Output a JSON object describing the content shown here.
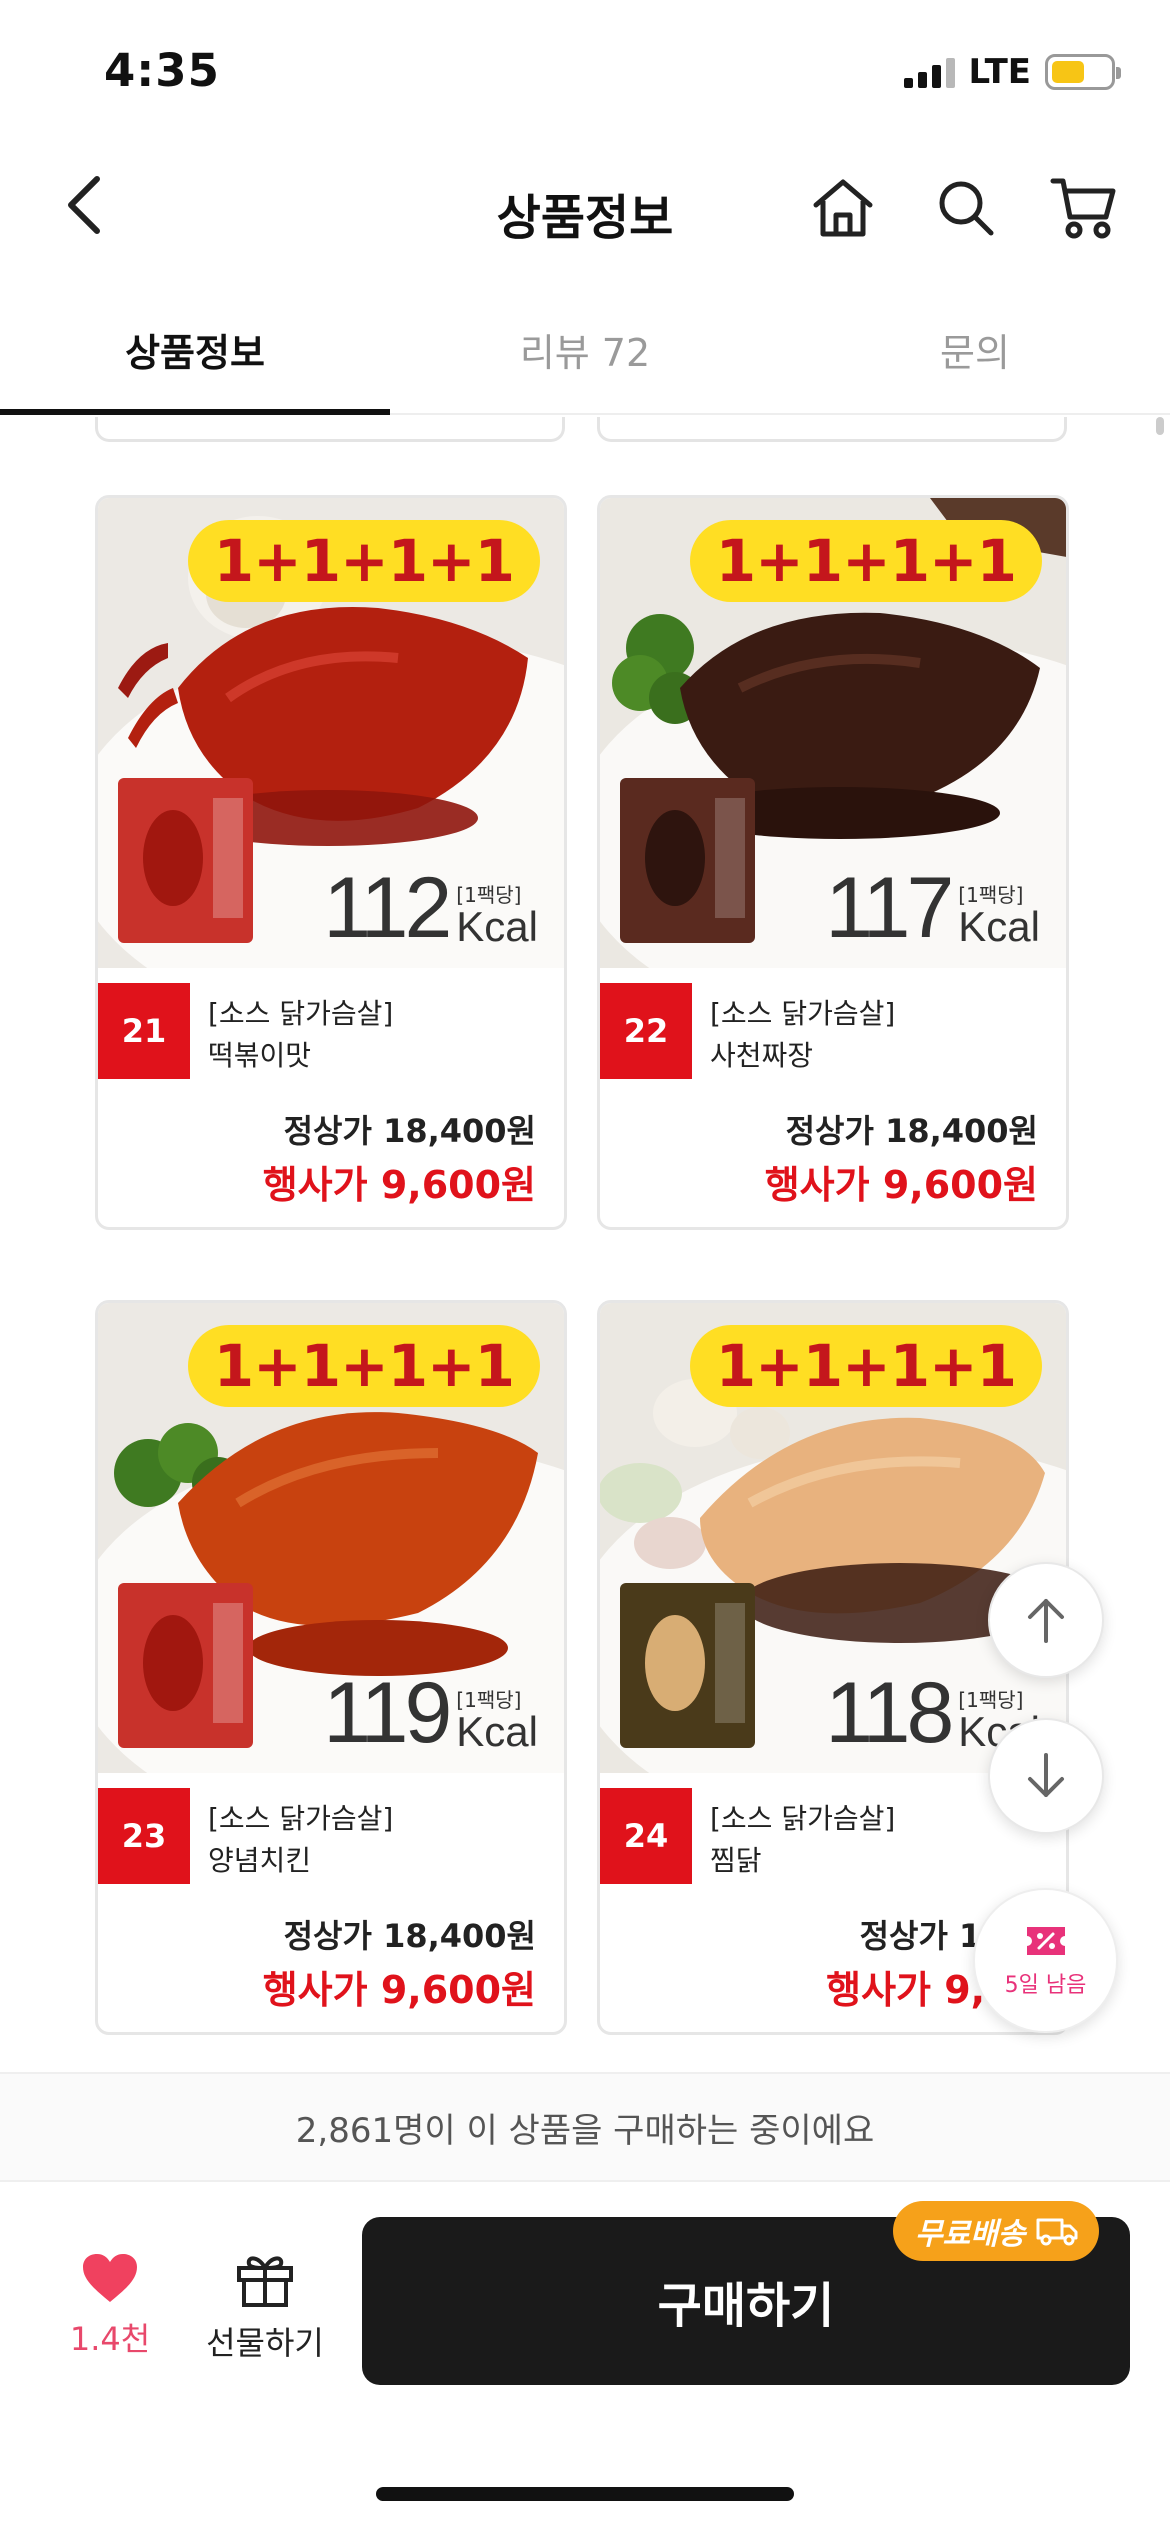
{
  "status_bar": {
    "time": "4:35",
    "network": "LTE",
    "signal_bars": 3,
    "battery_level": 0.58
  },
  "nav": {
    "title": "상품정보",
    "icons": [
      "back-icon",
      "home-icon",
      "search-icon",
      "cart-icon"
    ]
  },
  "tabs": [
    {
      "label": "상품정보",
      "active": true
    },
    {
      "label": "리뷰 72",
      "active": false
    },
    {
      "label": "문의",
      "active": false
    }
  ],
  "products": [
    {
      "badge": "1+1+1+1",
      "kcal": "112",
      "kcal_per": "[1팩당]",
      "kcal_unit": "Kcal",
      "number": "21",
      "category": "[소스 닭가슴살]",
      "name": "떡볶이맛",
      "regular_price": "정상가 18,400원",
      "sale_price": "행사가 9,600원",
      "sauce_color": "#b3200f"
    },
    {
      "badge": "1+1+1+1",
      "kcal": "117",
      "kcal_per": "[1팩당]",
      "kcal_unit": "Kcal",
      "number": "22",
      "category": "[소스 닭가슴살]",
      "name": "사천짜장",
      "regular_price": "정상가 18,400원",
      "sale_price": "행사가 9,600원",
      "sauce_color": "#3a1b12"
    },
    {
      "badge": "1+1+1+1",
      "kcal": "119",
      "kcal_per": "[1팩당]",
      "kcal_unit": "Kcal",
      "number": "23",
      "category": "[소스 닭가슴살]",
      "name": "양념치킨",
      "regular_price": "정상가 18,400원",
      "sale_price": "행사가 9,600원",
      "sauce_color": "#c8420f"
    },
    {
      "badge": "1+1+1+1",
      "kcal": "118",
      "kcal_per": "[1팩당]",
      "kcal_unit": "Kcal",
      "number": "24",
      "category": "[소스 닭가슴살]",
      "name": "찜닭",
      "regular_price": "정상가 18,4",
      "sale_price": "행사가 9,60",
      "sauce_color": "#e8b27e"
    }
  ],
  "floating": {
    "coupon_label": "5일 남음"
  },
  "buyers_text": "2,861명이 이 상품을 구매하는 중이에요",
  "bottom": {
    "like_count": "1.4천",
    "gift_label": "선물하기",
    "buy_label": "구매하기",
    "shipping_badge": "무료배송"
  },
  "colors": {
    "accent_red": "#e0121b",
    "promo_yellow": "#ffde23",
    "shipping_orange": "#f6a11a",
    "like_pink": "#e8486b"
  }
}
